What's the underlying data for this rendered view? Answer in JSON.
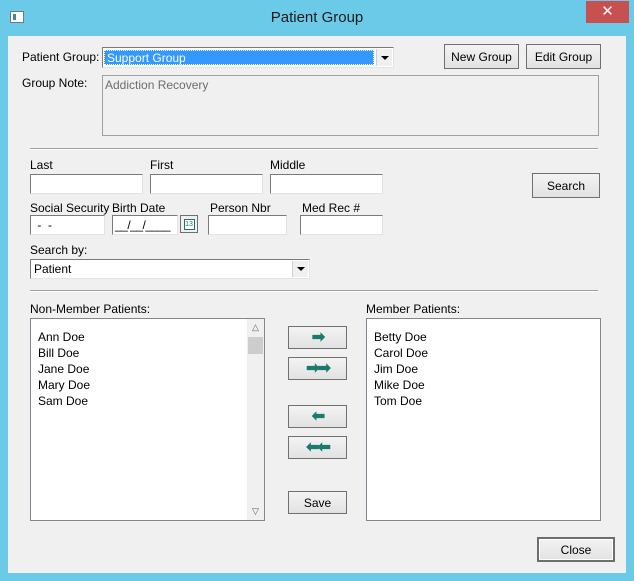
{
  "window": {
    "title": "Patient Group",
    "close_glyph": "✕"
  },
  "group": {
    "label": "Patient Group:",
    "selected": "Support Group",
    "new_button": "New Group",
    "edit_button": "Edit Group",
    "note_label": "Group Note:",
    "note_value": "Addiction Recovery"
  },
  "search": {
    "last_label": "Last",
    "first_label": "First",
    "middle_label": "Middle",
    "search_button": "Search",
    "ssn_label": "Social Security",
    "ssn_value": " -  -",
    "birth_label": "Birth Date",
    "birth_value": "__/__/____",
    "calendar_icon_text": "13",
    "person_nbr_label": "Person Nbr",
    "med_rec_label": "Med Rec #",
    "search_by_label": "Search by:",
    "search_by_value": "Patient"
  },
  "lists": {
    "non_member_label": "Non-Member Patients:",
    "non_members": [
      "Ann Doe",
      "Bill Doe",
      "Jane Doe",
      "Mary Doe",
      "Sam Doe"
    ],
    "member_label": "Member Patients:",
    "members": [
      "Betty Doe",
      "Carol Doe",
      "Jim Doe",
      "Mike Doe",
      "Tom Doe"
    ]
  },
  "transfer": {
    "add_one": "➡",
    "add_all": "➡➡",
    "remove_one": "⬅",
    "remove_all": "⬅⬅",
    "save_button": "Save"
  },
  "footer": {
    "close_button": "Close"
  },
  "colors": {
    "titlebar": "#6ccae9",
    "selection": "#3399ff",
    "arrow": "#1b7a6e"
  }
}
